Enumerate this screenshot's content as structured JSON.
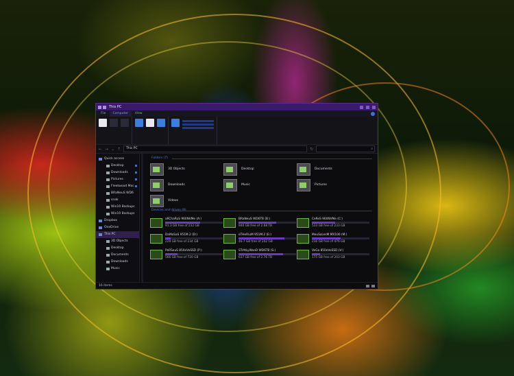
{
  "window": {
    "title": "This PC"
  },
  "tabs": [
    {
      "label": "File"
    },
    {
      "label": "Computer"
    },
    {
      "label": "View"
    }
  ],
  "address": {
    "path": "This PC",
    "search_placeholder": ""
  },
  "sidebar": {
    "items": [
      {
        "label": "Quick access",
        "level": 0
      },
      {
        "label": "Desktop",
        "level": 1
      },
      {
        "label": "Downloads",
        "level": 1
      },
      {
        "label": "Pictures",
        "level": 1
      },
      {
        "label": "Fleetwood Mac",
        "level": 1
      },
      {
        "label": "BRaNeuS WD6",
        "level": 1
      },
      {
        "label": "snak",
        "level": 1
      },
      {
        "label": "Win10 Backups",
        "level": 1
      },
      {
        "label": "Win10 Backups",
        "level": 1
      },
      {
        "label": "Dropbox",
        "level": 0
      },
      {
        "label": "OneDrive",
        "level": 0
      },
      {
        "label": "This PC",
        "level": 0
      },
      {
        "label": "3D Objects",
        "level": 1
      },
      {
        "label": "Desktop",
        "level": 1
      },
      {
        "label": "Documents",
        "level": 1
      },
      {
        "label": "Downloads",
        "level": 1
      },
      {
        "label": "Music",
        "level": 1
      }
    ]
  },
  "folders_group": {
    "label": "Folders (7)"
  },
  "folders": [
    "3D Objects",
    "Desktop",
    "Documents",
    "Downloads",
    "Music",
    "Pictures",
    "Videos"
  ],
  "drives_group": {
    "label": "Devices and drives (9)"
  },
  "drives": [
    {
      "name": "aRChaRuS 960NVMe (A:)",
      "free": "91.3 GB free of 232 GB",
      "used": 0.61
    },
    {
      "name": "BRaNeuS WD6TB (B:)",
      "free": "940 GB free of 2.68 TB",
      "used": 0.66
    },
    {
      "name": "CeReS 960NVMe (C:)",
      "free": "533 GB free of 233 GB",
      "used": 0.4
    },
    {
      "name": "DaMoSaS 951M.2 (D:)",
      "free": "229 GB free of 234 GB",
      "used": 0.1
    },
    {
      "name": "eTHeRiuM 951M.2 (E:)",
      "free": "46.7 GB free of 242 GB",
      "used": 0.8
    },
    {
      "name": "MeuSoLesM MX100 (M:)",
      "free": "236 GB free of 476 GB",
      "used": 0.5
    },
    {
      "name": "PeRSeuS 850eVoSSD (P:)",
      "free": "566 GB free of 720 GB",
      "used": 0.21
    },
    {
      "name": "STrAtLyWooD WD6TB (S:)",
      "free": "637 GB free of 2.76 TB",
      "used": 0.77
    },
    {
      "name": "VeGa 850eVoSSD (V:)",
      "free": "175 GB free of 203 GB",
      "used": 0.14
    }
  ],
  "status": {
    "count": "16 items"
  }
}
